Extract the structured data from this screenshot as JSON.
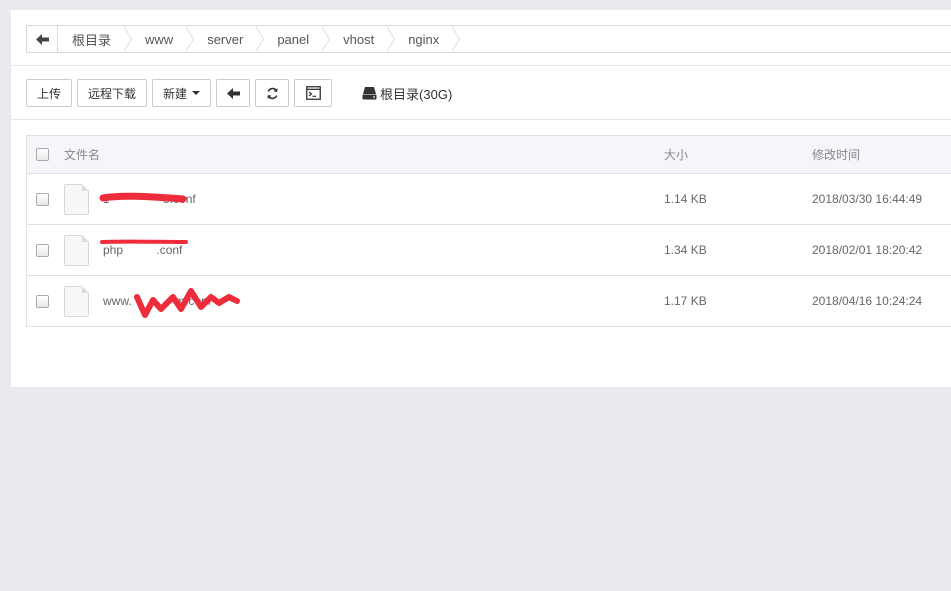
{
  "breadcrumb": {
    "items": [
      {
        "label": "根目录"
      },
      {
        "label": "www"
      },
      {
        "label": "server"
      },
      {
        "label": "panel"
      },
      {
        "label": "vhost"
      },
      {
        "label": "nginx"
      }
    ]
  },
  "toolbar": {
    "upload": "上传",
    "remote_download": "远程下载",
    "new": "新建",
    "disk_label": "根目录(30G)"
  },
  "table": {
    "headers": {
      "name": "文件名",
      "size": "大小",
      "modified": "修改时间"
    },
    "rows": [
      {
        "name": "1                5.conf",
        "size": "1.14 KB",
        "modified": "2018/03/30 16:44:49"
      },
      {
        "name": "php          .conf",
        "size": "1.34 KB",
        "modified": "2018/02/01 18:20:42"
      },
      {
        "name": "www.             m.conf",
        "size": "1.17 KB",
        "modified": "2018/04/16 10:24:24"
      }
    ]
  },
  "colors": {
    "redaction": "#ee2c3c",
    "background": "#e8eaed"
  }
}
